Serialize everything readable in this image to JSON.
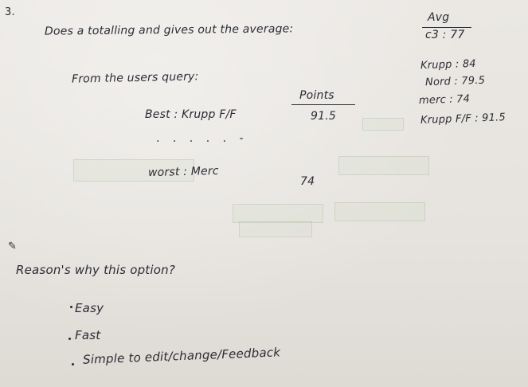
{
  "question_number": "3.",
  "intro_line": "Does a totalling and gives out the average:",
  "avg_header": "Avg",
  "avg_c3": "c3 : 77",
  "query_label": "From the users query:",
  "points_header": "Points",
  "best_label": "Best : Krupp F/F",
  "best_points": "91.5",
  "dots": ". . . . . -",
  "worst_label": "worst : Merc",
  "worst_points": "74",
  "side_list": [
    "Krupp : 84",
    "Nord : 79.5",
    "merc : 74",
    "Krupp F/F : 91.5"
  ],
  "reason_label": "Reason's why this option?",
  "reasons": [
    "Easy",
    "Fast",
    "Simple to edit/change/Feedback"
  ],
  "colors": {
    "paper": "#e7e4df",
    "ink": "#2b2b33"
  }
}
